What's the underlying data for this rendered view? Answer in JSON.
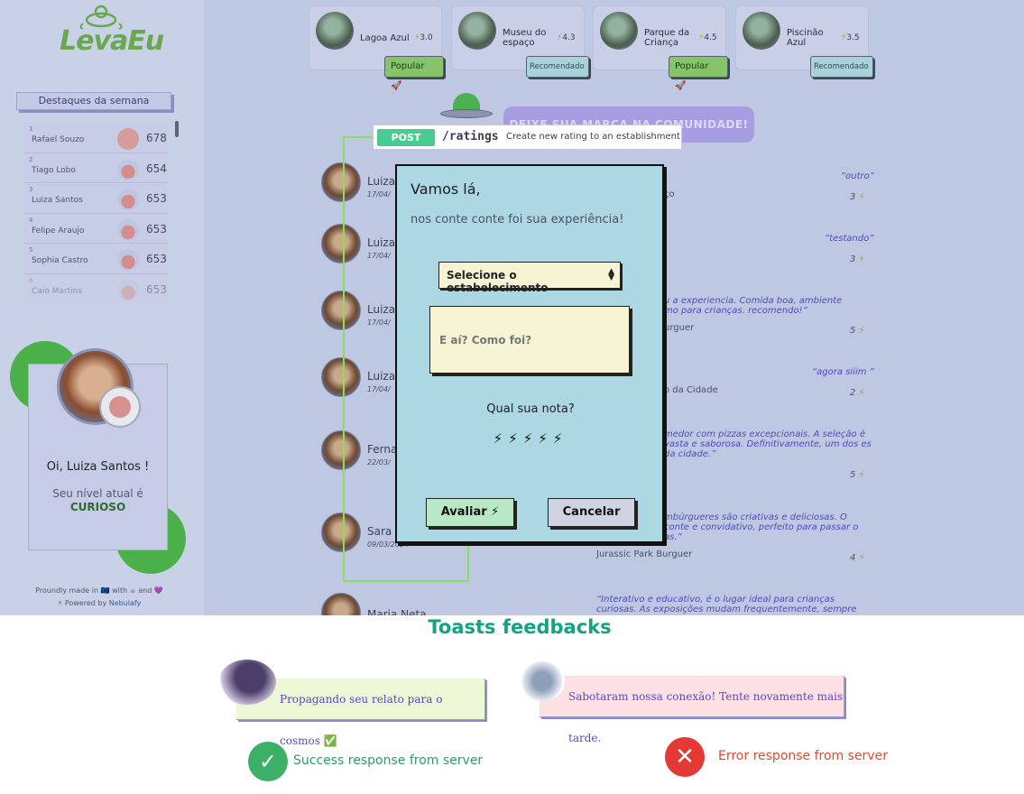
{
  "sidebar": {
    "logo_text": "LevaEu",
    "highlights_title": "Destaques da semana",
    "ranking": [
      {
        "rank": "1",
        "name": "Rafael Souzo",
        "points": "678"
      },
      {
        "rank": "2",
        "name": "Tiago Lobo",
        "points": "654"
      },
      {
        "rank": "3",
        "name": "Luiza Santos",
        "points": "653"
      },
      {
        "rank": "4",
        "name": "Felipe Araujo",
        "points": "653"
      },
      {
        "rank": "5",
        "name": "Sophia Castro",
        "points": "653"
      },
      {
        "rank": "6",
        "name": "Caio Martins",
        "points": "653"
      }
    ],
    "profile": {
      "greeting": "Oi, Luiza Santos !",
      "level_label": "Seu nível atual é",
      "level_value": "CURIOSO"
    },
    "footer": {
      "made": "Proundly made in 🇪🇺 with ☕ and 💜",
      "powered_prefix": "⚡ Powered by ",
      "powered_brand": "Nebulafy"
    }
  },
  "establishments": [
    {
      "name": "Lagoa Azul",
      "rating": "3.0",
      "badge": "Popular 🚀"
    },
    {
      "name": "Museu do espaço",
      "rating": "4.3",
      "badge": "Recomendado"
    },
    {
      "name": "Parque da Criança",
      "rating": "4.5",
      "badge": "Popular 🚀"
    },
    {
      "name": "Piscinão Azul",
      "rating": "3.5",
      "badge": "Recomendado"
    }
  ],
  "community_button": "DEIXE SUA MARCA NA COMUNIDADE!",
  "feed": [
    {
      "user": "Luiza",
      "date": "17/04/",
      "quote": "“outro”",
      "place": "ço",
      "score": "3"
    },
    {
      "user": "Luiza",
      "date": "17/04/",
      "quote": "“testando”",
      "place": "",
      "score": "3"
    },
    {
      "user": "Luiza",
      "date": "17/04/",
      "quote": "u a experiencia. Comida boa, ambiente mo para crianças. recomendo!”",
      "place": "urguer",
      "score": "5"
    },
    {
      "user": "Luiza",
      "date": "17/04/",
      "quote": "“agora siiim ”",
      "place": "o da Cidade",
      "score": "2"
    },
    {
      "user": "Ferna",
      "date": "22/03/",
      "quote": "medor com pizzas excepcionais. A seleção é vasta e saborosa. Definitivamente, um dos es da cidade.”",
      "place": "",
      "score": "5"
    },
    {
      "user": "Sara",
      "date": "09/03/2024",
      "quote": "mbúrgueres são criativas e deliciosas. O conte e convidativo, perfeito para passar o as.”",
      "place": "Jurassic Park Burguer",
      "score": "4"
    },
    {
      "user": "Maria Neta",
      "date": "",
      "quote": "“Interativo e educativo, é o lugar ideal para crianças curiosas. As exposições mudam frequentemente, sempre",
      "place": "",
      "score": ""
    }
  ],
  "api": {
    "method": "POST",
    "path": "/ratings",
    "description": "Create new rating to an establishment"
  },
  "modal": {
    "title": "Vamos lá,",
    "subtitle": "nos conte conte foi sua experiência!",
    "select_value": "Selecione o estabelecimento",
    "textarea_placeholder": "E aí? Como foi?",
    "rating_question": "Qual sua nota?",
    "rating_bolts": "⚡⚡⚡⚡⚡",
    "submit_label": "Avaliar ⚡",
    "cancel_label": "Cancelar"
  },
  "annotations": {
    "toasts_title": "Toasts feedbacks",
    "success_toast": "Propagando seu relato para o cosmos ✅",
    "error_toast": "Sabotaram nossa conexão! Tente novamente mais tarde.",
    "success_label": "Success response from server",
    "error_label": "Error response from server"
  },
  "colors": {
    "accent_green": "#14a37f",
    "post_green": "#49cc90",
    "modal_bg": "#acd8e3",
    "error_red": "#e53935"
  }
}
